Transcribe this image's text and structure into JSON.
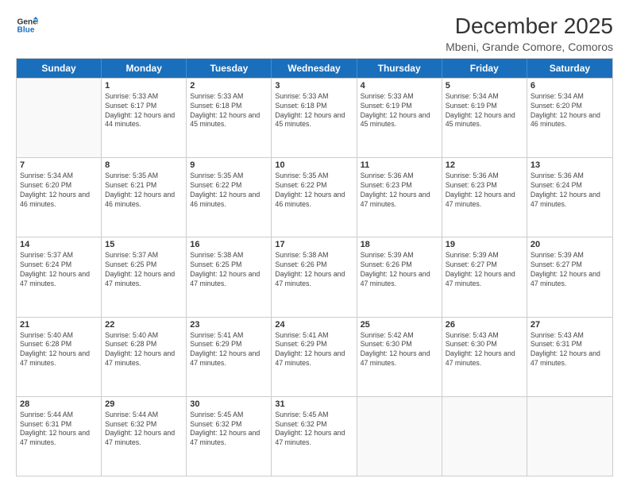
{
  "logo": {
    "line1": "General",
    "line2": "Blue"
  },
  "title": "December 2025",
  "subtitle": "Mbeni, Grande Comore, Comoros",
  "days": [
    "Sunday",
    "Monday",
    "Tuesday",
    "Wednesday",
    "Thursday",
    "Friday",
    "Saturday"
  ],
  "weeks": [
    [
      {
        "day": "",
        "sunrise": "",
        "sunset": "",
        "daylight": ""
      },
      {
        "day": "1",
        "sunrise": "Sunrise: 5:33 AM",
        "sunset": "Sunset: 6:17 PM",
        "daylight": "Daylight: 12 hours and 44 minutes."
      },
      {
        "day": "2",
        "sunrise": "Sunrise: 5:33 AM",
        "sunset": "Sunset: 6:18 PM",
        "daylight": "Daylight: 12 hours and 45 minutes."
      },
      {
        "day": "3",
        "sunrise": "Sunrise: 5:33 AM",
        "sunset": "Sunset: 6:18 PM",
        "daylight": "Daylight: 12 hours and 45 minutes."
      },
      {
        "day": "4",
        "sunrise": "Sunrise: 5:33 AM",
        "sunset": "Sunset: 6:19 PM",
        "daylight": "Daylight: 12 hours and 45 minutes."
      },
      {
        "day": "5",
        "sunrise": "Sunrise: 5:34 AM",
        "sunset": "Sunset: 6:19 PM",
        "daylight": "Daylight: 12 hours and 45 minutes."
      },
      {
        "day": "6",
        "sunrise": "Sunrise: 5:34 AM",
        "sunset": "Sunset: 6:20 PM",
        "daylight": "Daylight: 12 hours and 46 minutes."
      }
    ],
    [
      {
        "day": "7",
        "sunrise": "Sunrise: 5:34 AM",
        "sunset": "Sunset: 6:20 PM",
        "daylight": "Daylight: 12 hours and 46 minutes."
      },
      {
        "day": "8",
        "sunrise": "Sunrise: 5:35 AM",
        "sunset": "Sunset: 6:21 PM",
        "daylight": "Daylight: 12 hours and 46 minutes."
      },
      {
        "day": "9",
        "sunrise": "Sunrise: 5:35 AM",
        "sunset": "Sunset: 6:22 PM",
        "daylight": "Daylight: 12 hours and 46 minutes."
      },
      {
        "day": "10",
        "sunrise": "Sunrise: 5:35 AM",
        "sunset": "Sunset: 6:22 PM",
        "daylight": "Daylight: 12 hours and 46 minutes."
      },
      {
        "day": "11",
        "sunrise": "Sunrise: 5:36 AM",
        "sunset": "Sunset: 6:23 PM",
        "daylight": "Daylight: 12 hours and 47 minutes."
      },
      {
        "day": "12",
        "sunrise": "Sunrise: 5:36 AM",
        "sunset": "Sunset: 6:23 PM",
        "daylight": "Daylight: 12 hours and 47 minutes."
      },
      {
        "day": "13",
        "sunrise": "Sunrise: 5:36 AM",
        "sunset": "Sunset: 6:24 PM",
        "daylight": "Daylight: 12 hours and 47 minutes."
      }
    ],
    [
      {
        "day": "14",
        "sunrise": "Sunrise: 5:37 AM",
        "sunset": "Sunset: 6:24 PM",
        "daylight": "Daylight: 12 hours and 47 minutes."
      },
      {
        "day": "15",
        "sunrise": "Sunrise: 5:37 AM",
        "sunset": "Sunset: 6:25 PM",
        "daylight": "Daylight: 12 hours and 47 minutes."
      },
      {
        "day": "16",
        "sunrise": "Sunrise: 5:38 AM",
        "sunset": "Sunset: 6:25 PM",
        "daylight": "Daylight: 12 hours and 47 minutes."
      },
      {
        "day": "17",
        "sunrise": "Sunrise: 5:38 AM",
        "sunset": "Sunset: 6:26 PM",
        "daylight": "Daylight: 12 hours and 47 minutes."
      },
      {
        "day": "18",
        "sunrise": "Sunrise: 5:39 AM",
        "sunset": "Sunset: 6:26 PM",
        "daylight": "Daylight: 12 hours and 47 minutes."
      },
      {
        "day": "19",
        "sunrise": "Sunrise: 5:39 AM",
        "sunset": "Sunset: 6:27 PM",
        "daylight": "Daylight: 12 hours and 47 minutes."
      },
      {
        "day": "20",
        "sunrise": "Sunrise: 5:39 AM",
        "sunset": "Sunset: 6:27 PM",
        "daylight": "Daylight: 12 hours and 47 minutes."
      }
    ],
    [
      {
        "day": "21",
        "sunrise": "Sunrise: 5:40 AM",
        "sunset": "Sunset: 6:28 PM",
        "daylight": "Daylight: 12 hours and 47 minutes."
      },
      {
        "day": "22",
        "sunrise": "Sunrise: 5:40 AM",
        "sunset": "Sunset: 6:28 PM",
        "daylight": "Daylight: 12 hours and 47 minutes."
      },
      {
        "day": "23",
        "sunrise": "Sunrise: 5:41 AM",
        "sunset": "Sunset: 6:29 PM",
        "daylight": "Daylight: 12 hours and 47 minutes."
      },
      {
        "day": "24",
        "sunrise": "Sunrise: 5:41 AM",
        "sunset": "Sunset: 6:29 PM",
        "daylight": "Daylight: 12 hours and 47 minutes."
      },
      {
        "day": "25",
        "sunrise": "Sunrise: 5:42 AM",
        "sunset": "Sunset: 6:30 PM",
        "daylight": "Daylight: 12 hours and 47 minutes."
      },
      {
        "day": "26",
        "sunrise": "Sunrise: 5:43 AM",
        "sunset": "Sunset: 6:30 PM",
        "daylight": "Daylight: 12 hours and 47 minutes."
      },
      {
        "day": "27",
        "sunrise": "Sunrise: 5:43 AM",
        "sunset": "Sunset: 6:31 PM",
        "daylight": "Daylight: 12 hours and 47 minutes."
      }
    ],
    [
      {
        "day": "28",
        "sunrise": "Sunrise: 5:44 AM",
        "sunset": "Sunset: 6:31 PM",
        "daylight": "Daylight: 12 hours and 47 minutes."
      },
      {
        "day": "29",
        "sunrise": "Sunrise: 5:44 AM",
        "sunset": "Sunset: 6:32 PM",
        "daylight": "Daylight: 12 hours and 47 minutes."
      },
      {
        "day": "30",
        "sunrise": "Sunrise: 5:45 AM",
        "sunset": "Sunset: 6:32 PM",
        "daylight": "Daylight: 12 hours and 47 minutes."
      },
      {
        "day": "31",
        "sunrise": "Sunrise: 5:45 AM",
        "sunset": "Sunset: 6:32 PM",
        "daylight": "Daylight: 12 hours and 47 minutes."
      },
      {
        "day": "",
        "sunrise": "",
        "sunset": "",
        "daylight": ""
      },
      {
        "day": "",
        "sunrise": "",
        "sunset": "",
        "daylight": ""
      },
      {
        "day": "",
        "sunrise": "",
        "sunset": "",
        "daylight": ""
      }
    ]
  ]
}
